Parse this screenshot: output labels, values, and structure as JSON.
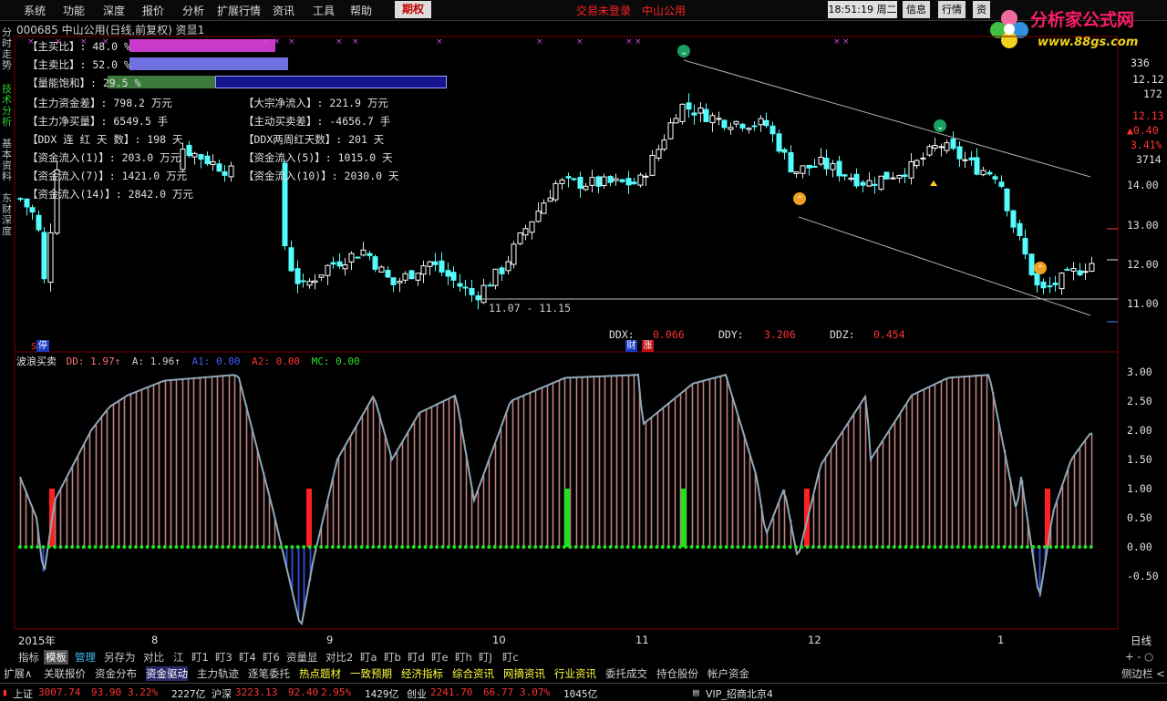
{
  "menu": {
    "items": [
      "系统",
      "功能",
      "深度",
      "报价",
      "分析",
      "扩展行情",
      "资讯",
      "工具",
      "帮助"
    ],
    "qiquan": "期权",
    "status_login": "交易未登录",
    "status_stock": "中山公用",
    "time": "18:51:19",
    "weekday": "周二",
    "btn_info": "信息",
    "btn_quote": "行情",
    "btn_extra": "资"
  },
  "logo": {
    "title": "分析家公式网",
    "url": "www.88gs.com"
  },
  "side_tabs": [
    "分时走势",
    "技术分析",
    "基本资料",
    "东财深度"
  ],
  "stock": {
    "code": "000685",
    "name": "中山公用",
    "period": "(日线,前复权)",
    "extra": "资显1"
  },
  "info_panel": {
    "zhumai": {
      "label": "【主买比】: 48.0 %",
      "pct": 48.0
    },
    "zhumai2": {
      "label": "【主卖比】: 52.0 %",
      "pct": 52.0
    },
    "liangneng": {
      "label": "【量能饱和】: 29.5 %",
      "pct": 29.5
    },
    "lines": [
      "【主力资金差】: 798.2 万元",
      "【主力净买量】: 6549.5 手",
      "【DDX 连 红 天 数】: 198 天",
      "【资金流入(1)】: 203.0 万元",
      "【资金流入(7)】: 1421.0 万元",
      "【资金流入(14)】: 2842.0 万元"
    ],
    "lines2": [
      "【大宗净流入】: 221.9 万元",
      "【主动买卖差】: -4656.7 手",
      "【DDX两周红天数】: 201 天",
      "【资金流入(5)】: 1015.0 天",
      "【资金流入(10)】: 2030.0 天"
    ]
  },
  "right_panel": {
    "v1": "336",
    "v2": "12.12",
    "v3": "172",
    "v4": "12.13",
    "v5": "0.40",
    "v6": "3.41%",
    "v7": "3714"
  },
  "main_axis": [
    "14.00",
    "13.00",
    "12.00",
    "11.00"
  ],
  "range_label": "11.07 - 11.15",
  "ddx": {
    "ddx_label": "DDX:",
    "ddx": "0.066",
    "ddy_label": "DDY:",
    "ddy": "3.206",
    "ddz_label": "DDZ:",
    "ddz": "0.454"
  },
  "badges": {
    "cai": "财",
    "zhang": "涨",
    "ting": "停",
    "s": "S"
  },
  "indicator": {
    "name": "波浪买卖",
    "dd": "DD: 1.97↑",
    "a": "A: 1.96↑",
    "a1": "A1: 0.00",
    "a2": "A2: 0.00",
    "mc": "MC: 0.00",
    "axis": [
      "3.00",
      "2.50",
      "2.00",
      "1.50",
      "1.00",
      "0.50",
      "0.00",
      "-0.50"
    ]
  },
  "xaxis": {
    "labels": [
      "2015年",
      "8",
      "9",
      "10",
      "11",
      "12",
      "1"
    ],
    "right": "日线"
  },
  "bottom_tabs": [
    "指标",
    "模板",
    "管理",
    "另存为",
    "对比",
    "江",
    "盯1",
    "盯3",
    "盯4",
    "盯6",
    "资量显",
    "对比2",
    "盯a",
    "盯b",
    "盯d",
    "盯e",
    "盯h",
    "盯J",
    "盯c"
  ],
  "bottom_tab_right": "+ - ○",
  "bottom_menu": [
    "扩展∧",
    "关联报价",
    "资金分布",
    "资金驱动",
    "主力轨迹",
    "逐笔委托",
    "热点题材",
    "一致预期",
    "经济指标",
    "综合资讯",
    "网摘资讯",
    "行业资讯",
    "委托成交",
    "持仓股份",
    "帐户资金"
  ],
  "bottom_menu_right": "侧边栏 <",
  "ticker": {
    "sh_name": "上证",
    "sh_val": "3007.74",
    "sh_chg": "93.90",
    "sh_pct": "3.22%",
    "sh_amt": "2227亿",
    "hs_name": "沪深",
    "hs_val": "3223.13",
    "hs_chg": "92.40",
    "hs_pct": "2.95%",
    "hs_amt": "1429亿",
    "cy_name": "创业",
    "cy_val": "2241.70",
    "cy_chg": "66.77",
    "cy_pct": "3.07%",
    "cy_amt": "1045亿",
    "server": "VIP_招商北京4"
  },
  "colors": {
    "up": "#ff3232",
    "down": "#54fcfc",
    "accent": "#c00000"
  }
}
